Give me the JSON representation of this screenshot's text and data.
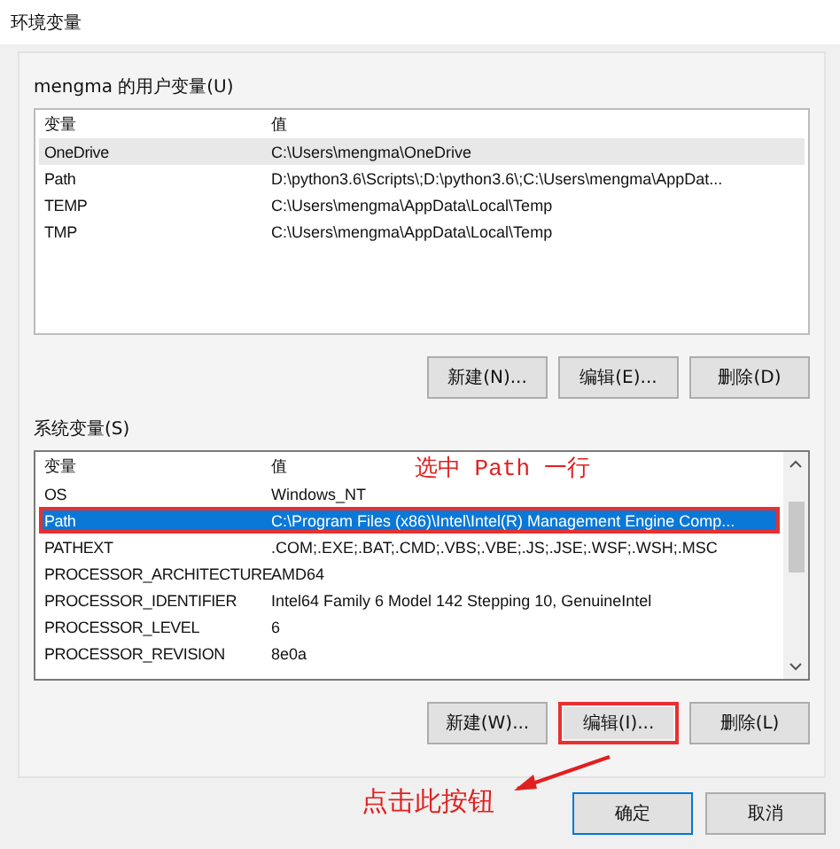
{
  "window": {
    "title": "环境变量"
  },
  "user_variables": {
    "label": "mengma 的用户变量(U)",
    "focused": false,
    "columns": [
      "变量",
      "值"
    ],
    "rows": [
      {
        "name": "OneDrive",
        "value": "C:\\Users\\mengma\\OneDrive",
        "selected": true,
        "highlighted": false
      },
      {
        "name": "Path",
        "value": "D:\\python3.6\\Scripts\\;D:\\python3.6\\;C:\\Users\\mengma\\AppDat...",
        "selected": false,
        "highlighted": false
      },
      {
        "name": "TEMP",
        "value": "C:\\Users\\mengma\\AppData\\Local\\Temp",
        "selected": false,
        "highlighted": false
      },
      {
        "name": "TMP",
        "value": "C:\\Users\\mengma\\AppData\\Local\\Temp",
        "selected": false,
        "highlighted": false
      }
    ],
    "buttons": [
      {
        "label": "新建(N)...",
        "highlighted": false
      },
      {
        "label": "编辑(E)...",
        "highlighted": false
      },
      {
        "label": "删除(D)",
        "highlighted": false
      }
    ]
  },
  "system_variables": {
    "label": "系统变量(S)",
    "focused": true,
    "columns": [
      "变量",
      "值"
    ],
    "note": "选中 Path 一行",
    "rows": [
      {
        "name": "OS",
        "value": "Windows_NT",
        "selected": false,
        "highlighted": false
      },
      {
        "name": "Path",
        "value": "C:\\Program Files (x86)\\Intel\\Intel(R) Management Engine Comp...",
        "selected": true,
        "highlighted": true
      },
      {
        "name": "PATHEXT",
        "value": ".COM;.EXE;.BAT;.CMD;.VBS;.VBE;.JS;.JSE;.WSF;.WSH;.MSC",
        "selected": false,
        "highlighted": false
      },
      {
        "name": "PROCESSOR_ARCHITECTURE",
        "value": "AMD64",
        "selected": false,
        "highlighted": false
      },
      {
        "name": "PROCESSOR_IDENTIFIER",
        "value": "Intel64 Family 6 Model 142 Stepping 10, GenuineIntel",
        "selected": false,
        "highlighted": false
      },
      {
        "name": "PROCESSOR_LEVEL",
        "value": "6",
        "selected": false,
        "highlighted": false
      },
      {
        "name": "PROCESSOR_REVISION",
        "value": "8e0a",
        "selected": false,
        "highlighted": false
      }
    ],
    "buttons": [
      {
        "label": "新建(W)...",
        "highlighted": false
      },
      {
        "label": "编辑(I)...",
        "highlighted": true
      },
      {
        "label": "删除(L)",
        "highlighted": false
      }
    ]
  },
  "callout": "点击此按钮",
  "buttons": [
    {
      "label": "确定",
      "default": true
    },
    {
      "label": "取消",
      "default": false
    }
  ]
}
